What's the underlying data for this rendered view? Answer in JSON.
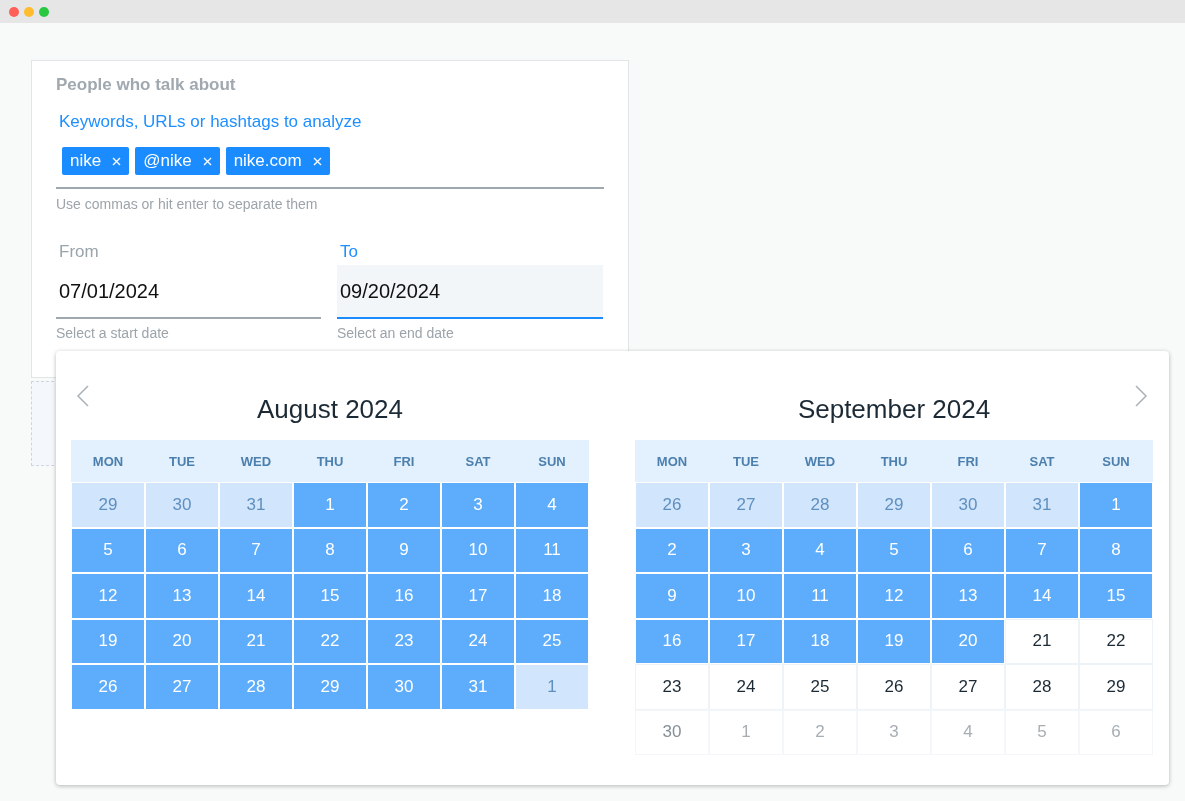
{
  "form": {
    "title": "People who talk about",
    "keywords": {
      "label": "Keywords, URLs or hashtags to analyze",
      "tags": [
        {
          "text": "nike"
        },
        {
          "text": "@nike"
        },
        {
          "text": "nike.com"
        }
      ],
      "hint": "Use commas or hit enter to separate them"
    },
    "dates": [
      {
        "label": "From",
        "value": "07/01/2024",
        "hint": "Select a start date",
        "focused": false
      },
      {
        "label": "To",
        "value": "09/20/2024",
        "hint": "Select an end date",
        "focused": true
      }
    ]
  },
  "calendar": {
    "months": [
      {
        "title": "August 2024",
        "weekdays": [
          "MON",
          "TUE",
          "WED",
          "THU",
          "FRI",
          "SAT",
          "SUN"
        ],
        "weeks": [
          [
            {
              "day": "29",
              "kind": "range-outside"
            },
            {
              "day": "30",
              "kind": "range-outside"
            },
            {
              "day": "31",
              "kind": "range-outside"
            },
            {
              "day": "1",
              "kind": "range"
            },
            {
              "day": "2",
              "kind": "range"
            },
            {
              "day": "3",
              "kind": "range"
            },
            {
              "day": "4",
              "kind": "range"
            }
          ],
          [
            {
              "day": "5",
              "kind": "range"
            },
            {
              "day": "6",
              "kind": "range"
            },
            {
              "day": "7",
              "kind": "range"
            },
            {
              "day": "8",
              "kind": "range"
            },
            {
              "day": "9",
              "kind": "range"
            },
            {
              "day": "10",
              "kind": "range"
            },
            {
              "day": "11",
              "kind": "range"
            }
          ],
          [
            {
              "day": "12",
              "kind": "range"
            },
            {
              "day": "13",
              "kind": "range"
            },
            {
              "day": "14",
              "kind": "range"
            },
            {
              "day": "15",
              "kind": "range"
            },
            {
              "day": "16",
              "kind": "range"
            },
            {
              "day": "17",
              "kind": "range"
            },
            {
              "day": "18",
              "kind": "range"
            }
          ],
          [
            {
              "day": "19",
              "kind": "range"
            },
            {
              "day": "20",
              "kind": "range"
            },
            {
              "day": "21",
              "kind": "range"
            },
            {
              "day": "22",
              "kind": "range"
            },
            {
              "day": "23",
              "kind": "range"
            },
            {
              "day": "24",
              "kind": "range"
            },
            {
              "day": "25",
              "kind": "range"
            }
          ],
          [
            {
              "day": "26",
              "kind": "range"
            },
            {
              "day": "27",
              "kind": "range"
            },
            {
              "day": "28",
              "kind": "range"
            },
            {
              "day": "29",
              "kind": "range"
            },
            {
              "day": "30",
              "kind": "range"
            },
            {
              "day": "31",
              "kind": "range"
            },
            {
              "day": "1",
              "kind": "range-outside"
            }
          ]
        ]
      },
      {
        "title": "September 2024",
        "weekdays": [
          "MON",
          "TUE",
          "WED",
          "THU",
          "FRI",
          "SAT",
          "SUN"
        ],
        "weeks": [
          [
            {
              "day": "26",
              "kind": "range-outside"
            },
            {
              "day": "27",
              "kind": "range-outside"
            },
            {
              "day": "28",
              "kind": "range-outside"
            },
            {
              "day": "29",
              "kind": "range-outside"
            },
            {
              "day": "30",
              "kind": "range-outside"
            },
            {
              "day": "31",
              "kind": "range-outside"
            },
            {
              "day": "1",
              "kind": "range"
            }
          ],
          [
            {
              "day": "2",
              "kind": "range"
            },
            {
              "day": "3",
              "kind": "range"
            },
            {
              "day": "4",
              "kind": "range"
            },
            {
              "day": "5",
              "kind": "range"
            },
            {
              "day": "6",
              "kind": "range"
            },
            {
              "day": "7",
              "kind": "range"
            },
            {
              "day": "8",
              "kind": "range"
            }
          ],
          [
            {
              "day": "9",
              "kind": "range"
            },
            {
              "day": "10",
              "kind": "range"
            },
            {
              "day": "11",
              "kind": "range"
            },
            {
              "day": "12",
              "kind": "range"
            },
            {
              "day": "13",
              "kind": "range"
            },
            {
              "day": "14",
              "kind": "range"
            },
            {
              "day": "15",
              "kind": "range"
            }
          ],
          [
            {
              "day": "16",
              "kind": "range"
            },
            {
              "day": "17",
              "kind": "range"
            },
            {
              "day": "18",
              "kind": "range"
            },
            {
              "day": "19",
              "kind": "range"
            },
            {
              "day": "20",
              "kind": "range"
            },
            {
              "day": "21",
              "kind": "day"
            },
            {
              "day": "22",
              "kind": "day"
            }
          ],
          [
            {
              "day": "23",
              "kind": "day"
            },
            {
              "day": "24",
              "kind": "day"
            },
            {
              "day": "25",
              "kind": "day"
            },
            {
              "day": "26",
              "kind": "day"
            },
            {
              "day": "27",
              "kind": "day"
            },
            {
              "day": "28",
              "kind": "day"
            },
            {
              "day": "29",
              "kind": "day"
            }
          ],
          [
            {
              "day": "30",
              "kind": "disabled"
            },
            {
              "day": "1",
              "kind": "outside"
            },
            {
              "day": "2",
              "kind": "outside"
            },
            {
              "day": "3",
              "kind": "outside"
            },
            {
              "day": "4",
              "kind": "outside"
            },
            {
              "day": "5",
              "kind": "outside"
            },
            {
              "day": "6",
              "kind": "outside"
            }
          ]
        ]
      }
    ]
  }
}
